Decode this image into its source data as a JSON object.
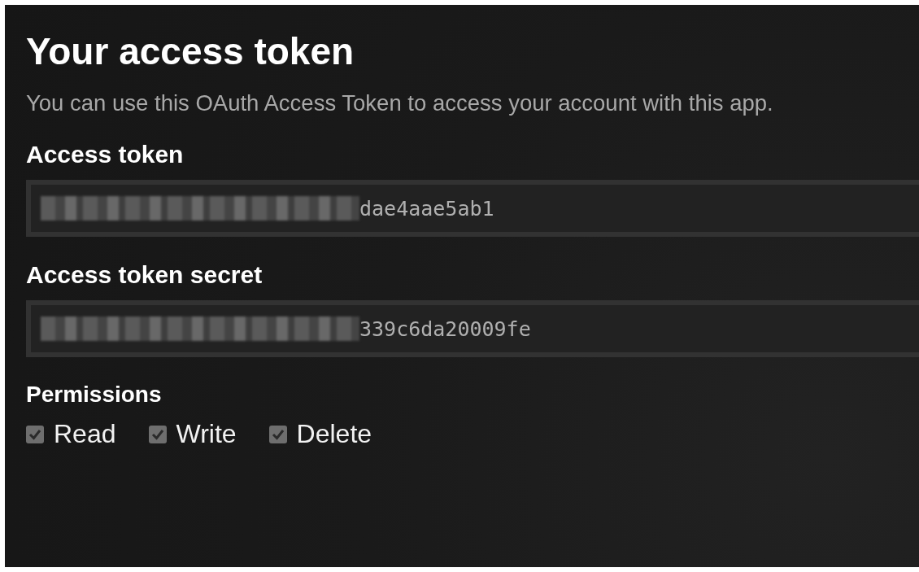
{
  "title": "Your access token",
  "description": "You can use this OAuth Access Token to access your account with this app.",
  "fields": [
    {
      "label": "Access token",
      "value": "dae4aae5ab1",
      "redacted": true
    },
    {
      "label": "Access token secret",
      "value": "339c6da20009fe",
      "redacted": true
    }
  ],
  "permissions": {
    "label": "Permissions",
    "items": [
      {
        "label": "Read",
        "checked": true,
        "disabled": true
      },
      {
        "label": "Write",
        "checked": true,
        "disabled": true
      },
      {
        "label": "Delete",
        "checked": true,
        "disabled": true
      }
    ]
  }
}
